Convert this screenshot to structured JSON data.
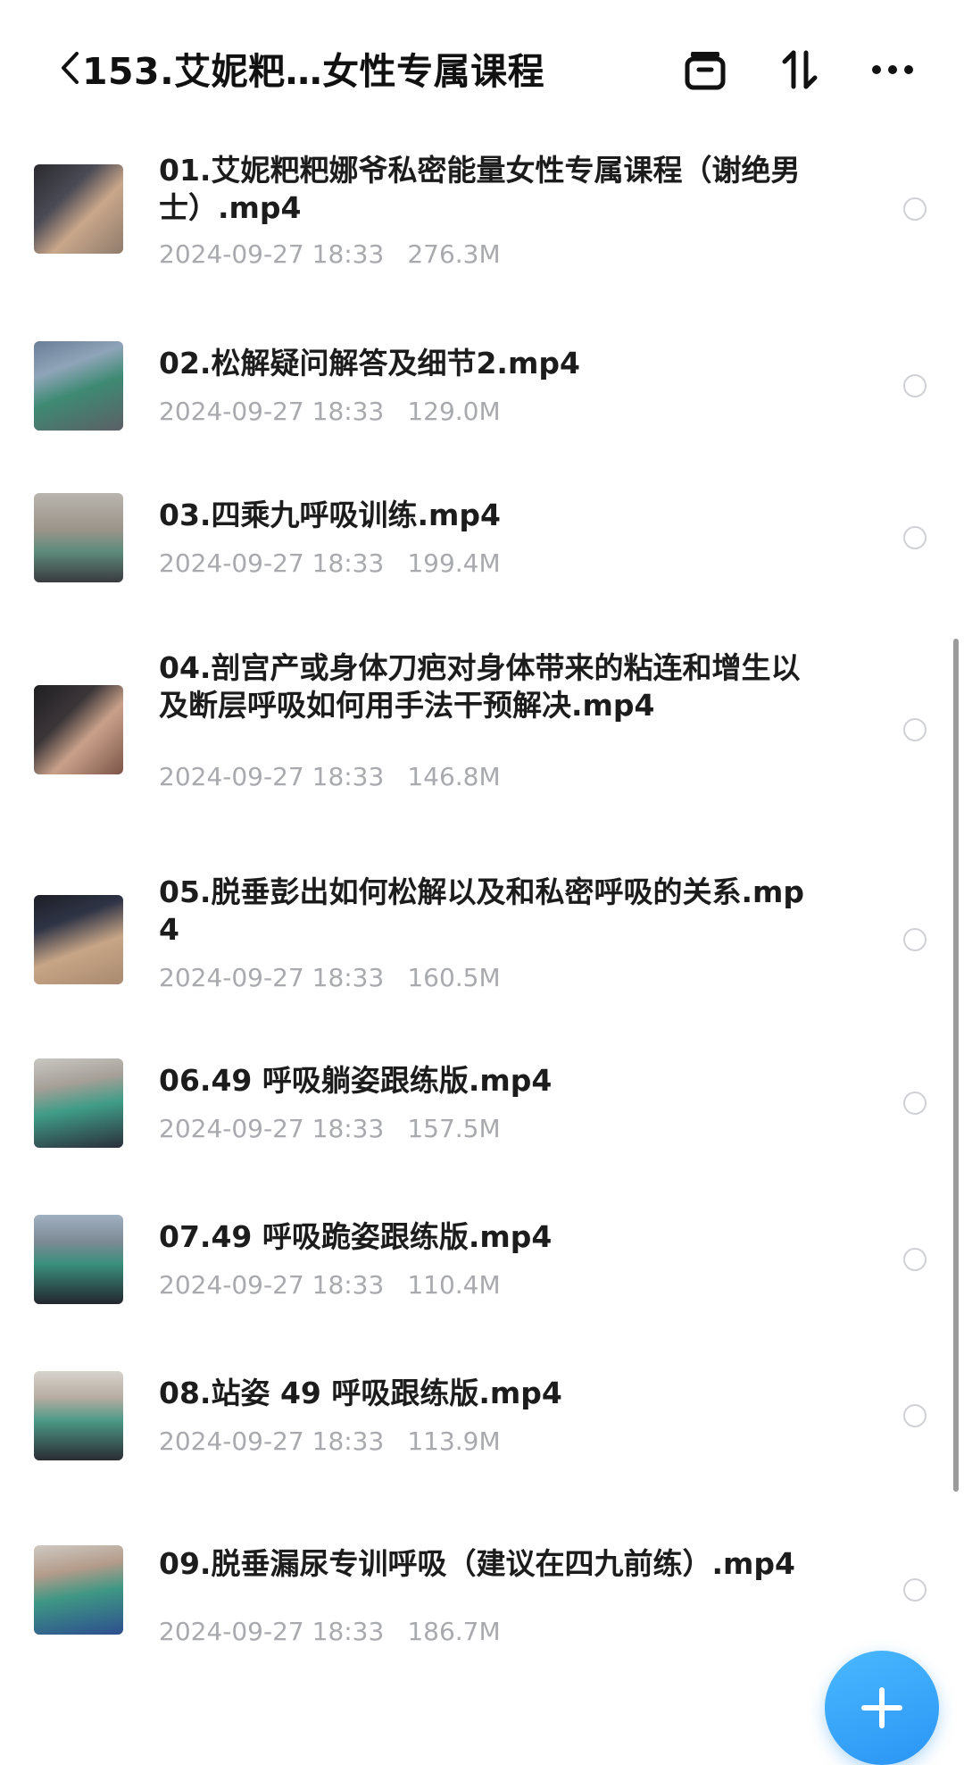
{
  "header": {
    "back_icon": "chevron-left-icon",
    "title": "153.艾妮粑…女性专属课程",
    "actions": [
      {
        "icon": "archive-box-icon"
      },
      {
        "icon": "sort-icon"
      },
      {
        "icon": "more-horizontal-icon"
      }
    ]
  },
  "files": [
    {
      "name": "01.艾妮粑粑娜爷私密能量女性专属课程（谢绝男士）.mp4",
      "date": "2024-09-27 18:33",
      "size": "276.3M"
    },
    {
      "name": "02.松解疑问解答及细节2.mp4",
      "date": "2024-09-27 18:33",
      "size": "129.0M"
    },
    {
      "name": "03.四乘九呼吸训练.mp4",
      "date": "2024-09-27 18:33",
      "size": "199.4M"
    },
    {
      "name": "04.剖宫产或身体刀疤对身体带来的粘连和增生以及断层呼吸如何用手法干预解决.mp4",
      "date": "2024-09-27 18:33",
      "size": "146.8M"
    },
    {
      "name": "05.脱垂彭出如何松解以及和私密呼吸的关系.mp4",
      "date": "2024-09-27 18:33",
      "size": "160.5M"
    },
    {
      "name": "06.49 呼吸躺姿跟练版.mp4",
      "date": "2024-09-27 18:33",
      "size": "157.5M"
    },
    {
      "name": "07.49 呼吸跪姿跟练版.mp4",
      "date": "2024-09-27 18:33",
      "size": "110.4M"
    },
    {
      "name": "08.站姿 49 呼吸跟练版.mp4",
      "date": "2024-09-27 18:33",
      "size": "113.9M"
    },
    {
      "name": "09.脱垂漏尿专训呼吸（建议在四九前练）.mp4",
      "date": "2024-09-27 18:33",
      "size": "186.7M"
    }
  ],
  "fab": {
    "icon": "plus-icon"
  },
  "colors": {
    "accent": "#2a95f4",
    "meta_text": "#a9aaae",
    "title_text": "#1c1c1c"
  }
}
